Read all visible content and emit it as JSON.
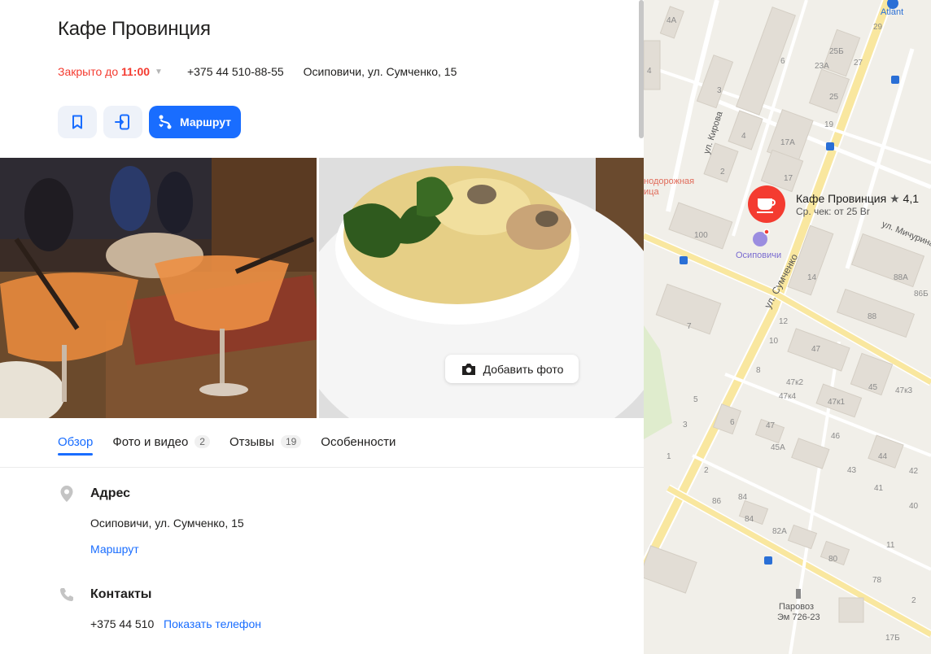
{
  "place": {
    "title": "Кафе Провинция",
    "status_prefix": "Закрыто до ",
    "status_time": "11:00",
    "phone": "+375 44 510-88-55",
    "address": "Осиповичи, ул. Сумченко, 15"
  },
  "actions": {
    "route_label": "Маршрут"
  },
  "photos": {
    "add_photo_label": "Добавить фото"
  },
  "tabs": [
    {
      "label": "Обзор",
      "count": ""
    },
    {
      "label": "Фото и видео",
      "count": "2"
    },
    {
      "label": "Отзывы",
      "count": "19"
    },
    {
      "label": "Особенности",
      "count": ""
    }
  ],
  "address_section": {
    "heading": "Адрес",
    "text": "Осиповичи, ул. Сумченко, 15",
    "route_link": "Маршрут"
  },
  "contacts_section": {
    "heading": "Контакты",
    "phone_partial": "+375 44 510",
    "show_phone_link": "Показать телефон"
  },
  "map": {
    "pin_name": "Кафе Провинция",
    "pin_rating": "4,1",
    "pin_check": "Ср. чек: от 25 Br",
    "landmark": "Осиповичи",
    "brand": "Atlant",
    "monument_line1": "Паровоз",
    "monument_line2": "Эм 726-23",
    "poi_partial": "нодорожная",
    "poi_partial2": "ица",
    "streets": {
      "kirova": "ул. Кирова",
      "sumchenko": "ул. Сумченко",
      "michurina": "ул. Мичурина"
    },
    "house_numbers": [
      "4А",
      "6",
      "25Б",
      "27",
      "23А",
      "29",
      "4",
      "3",
      "25",
      "19",
      "4",
      "17А",
      "2",
      "17",
      "100",
      "14",
      "88А",
      "86Б",
      "7",
      "12",
      "10",
      "88",
      "47",
      "8",
      "47к2",
      "47к3",
      "5",
      "47к4",
      "47к1",
      "45",
      "3",
      "6",
      "47",
      "46",
      "1",
      "45А",
      "44",
      "2",
      "43",
      "42",
      "86",
      "84",
      "41",
      "40",
      "84",
      "82А",
      "11",
      "80",
      "78",
      "2",
      "17Б"
    ]
  },
  "colors": {
    "accent": "#196dff",
    "closed": "#f43b30",
    "pin": "#f43b30",
    "road": "#f9e79f"
  }
}
